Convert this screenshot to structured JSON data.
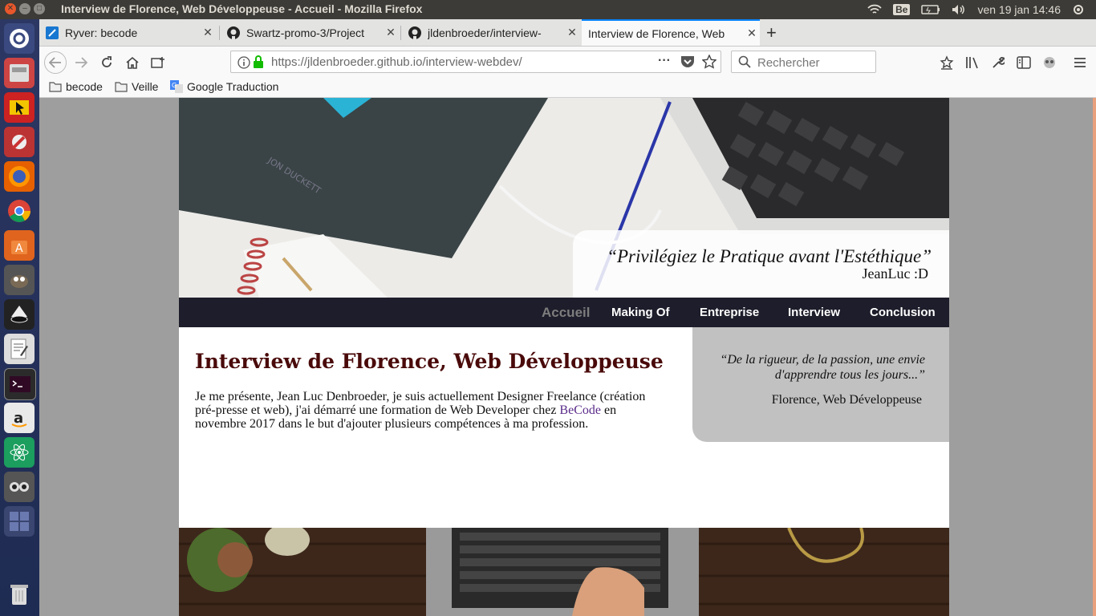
{
  "os": {
    "window_title": "Interview de Florence, Web Développeuse - Accueil - Mozilla Firefox",
    "keyboard_layout": "Be",
    "clock": "ven 19 jan 14:46"
  },
  "launcher": {
    "items": [
      "ubuntu-dash-icon",
      "file-cabinet-icon",
      "app-icon",
      "settings-tools-icon",
      "firefox-icon",
      "chrome-icon",
      "software-center-icon",
      "gimp-icon",
      "inkscape-icon",
      "text-editor-icon",
      "terminal-icon",
      "amazon-icon",
      "atom-icon",
      "app-icon-2",
      "workspaces-icon",
      "trash-icon"
    ]
  },
  "browser": {
    "tabs": [
      {
        "label": "Ryver: becode",
        "icon": "ryver-icon",
        "active": false
      },
      {
        "label": "Swartz-promo-3/Project",
        "icon": "github-icon",
        "active": false
      },
      {
        "label": "jldenbroeder/interview-",
        "icon": "github-icon",
        "active": false
      },
      {
        "label": "Interview de Florence, Web",
        "icon": "none",
        "active": true
      }
    ],
    "url_host": "https://jldenbroeder.github.io",
    "url_path": "/interview-webdev/",
    "search_placeholder": "Rechercher",
    "bookmarks": [
      {
        "label": "becode",
        "icon": "folder-icon"
      },
      {
        "label": "Veille",
        "icon": "folder-icon"
      },
      {
        "label": "Google Traduction",
        "icon": "google-translate-icon"
      }
    ]
  },
  "site": {
    "hero_quote": "“Privilégiez le Pratique avant l'Estéthique”",
    "hero_author": "JeanLuc :D",
    "nav": [
      {
        "label": "Accueil",
        "current": true
      },
      {
        "label": "Making Of",
        "current": false
      },
      {
        "label": "Entreprise",
        "current": false
      },
      {
        "label": "Interview",
        "current": false
      },
      {
        "label": "Conclusion",
        "current": false
      }
    ],
    "title": "Interview de Florence, Web Développeuse",
    "intro_before": "Je me présente, Jean Luc Denbroeder, je suis actuellement Designer Freelance (création pré-presse et web), j'ai démarré une formation de Web Developer chez ",
    "intro_link": "BeCode",
    "intro_after": " en novembre 2017 dans le but d'ajouter plusieurs compétences à ma profession.",
    "aside_quote": "“De la rigueur, de la passion, une envie d'apprendre tous les jours...”",
    "aside_author": "Florence, Web Développeuse"
  },
  "colors": {
    "firefox_accent": "#0a84ff",
    "site_nav_bg": "#1d1d2b",
    "heading": "#4a0a0a",
    "link": "#5a2b8a",
    "aside_bg": "#c1c1c1",
    "launcher_bg": "#25305a"
  }
}
